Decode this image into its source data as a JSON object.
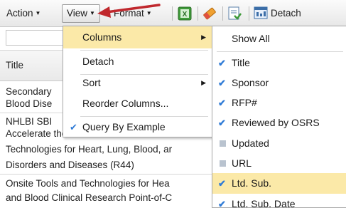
{
  "toolbar": {
    "action_label": "Action",
    "view_label": "View",
    "format_label": "Format",
    "detach_label": "Detach",
    "icons": [
      "export-excel-icon",
      "eraser-icon",
      "query-edit-icon",
      "detach-icon"
    ]
  },
  "grid": {
    "header_title": "Title",
    "rows": [
      {
        "lines": [
          "Secondary",
          "Blood Dise"
        ]
      },
      {
        "lines": [
          "NHLBI SBI",
          "Accelerate the Commercialization of",
          "Technologies for Heart, Lung, Blood, ar",
          "Disorders and Diseases (R44)"
        ]
      },
      {
        "lines": [
          "Onsite Tools and Technologies for Hea",
          "and Blood Clinical Research Point-of-C"
        ]
      }
    ]
  },
  "view_menu": {
    "items": [
      {
        "label": "Columns",
        "highlighted": true,
        "submenu": true
      },
      {
        "label": "Detach"
      },
      {
        "label": "Sort",
        "submenu": true
      },
      {
        "label": "Reorder Columns..."
      },
      {
        "label": "Query By Example",
        "checked": true
      }
    ]
  },
  "columns_menu": {
    "items": [
      {
        "label": "Show All",
        "state": "none"
      },
      {
        "label": "Title",
        "state": "checked"
      },
      {
        "label": "Sponsor",
        "state": "checked"
      },
      {
        "label": "RFP#",
        "state": "checked"
      },
      {
        "label": "Reviewed by OSRS",
        "state": "checked"
      },
      {
        "label": "Updated",
        "state": "unchecked"
      },
      {
        "label": "URL",
        "state": "unchecked"
      },
      {
        "label": "Ltd. Sub.",
        "state": "checked",
        "highlighted": true
      },
      {
        "label": "Ltd. Sub. Date",
        "state": "checked"
      }
    ]
  },
  "colors": {
    "highlight": "#fbe9a8",
    "check": "#2f7bd6",
    "annotation_arrow": "#c0282d"
  }
}
